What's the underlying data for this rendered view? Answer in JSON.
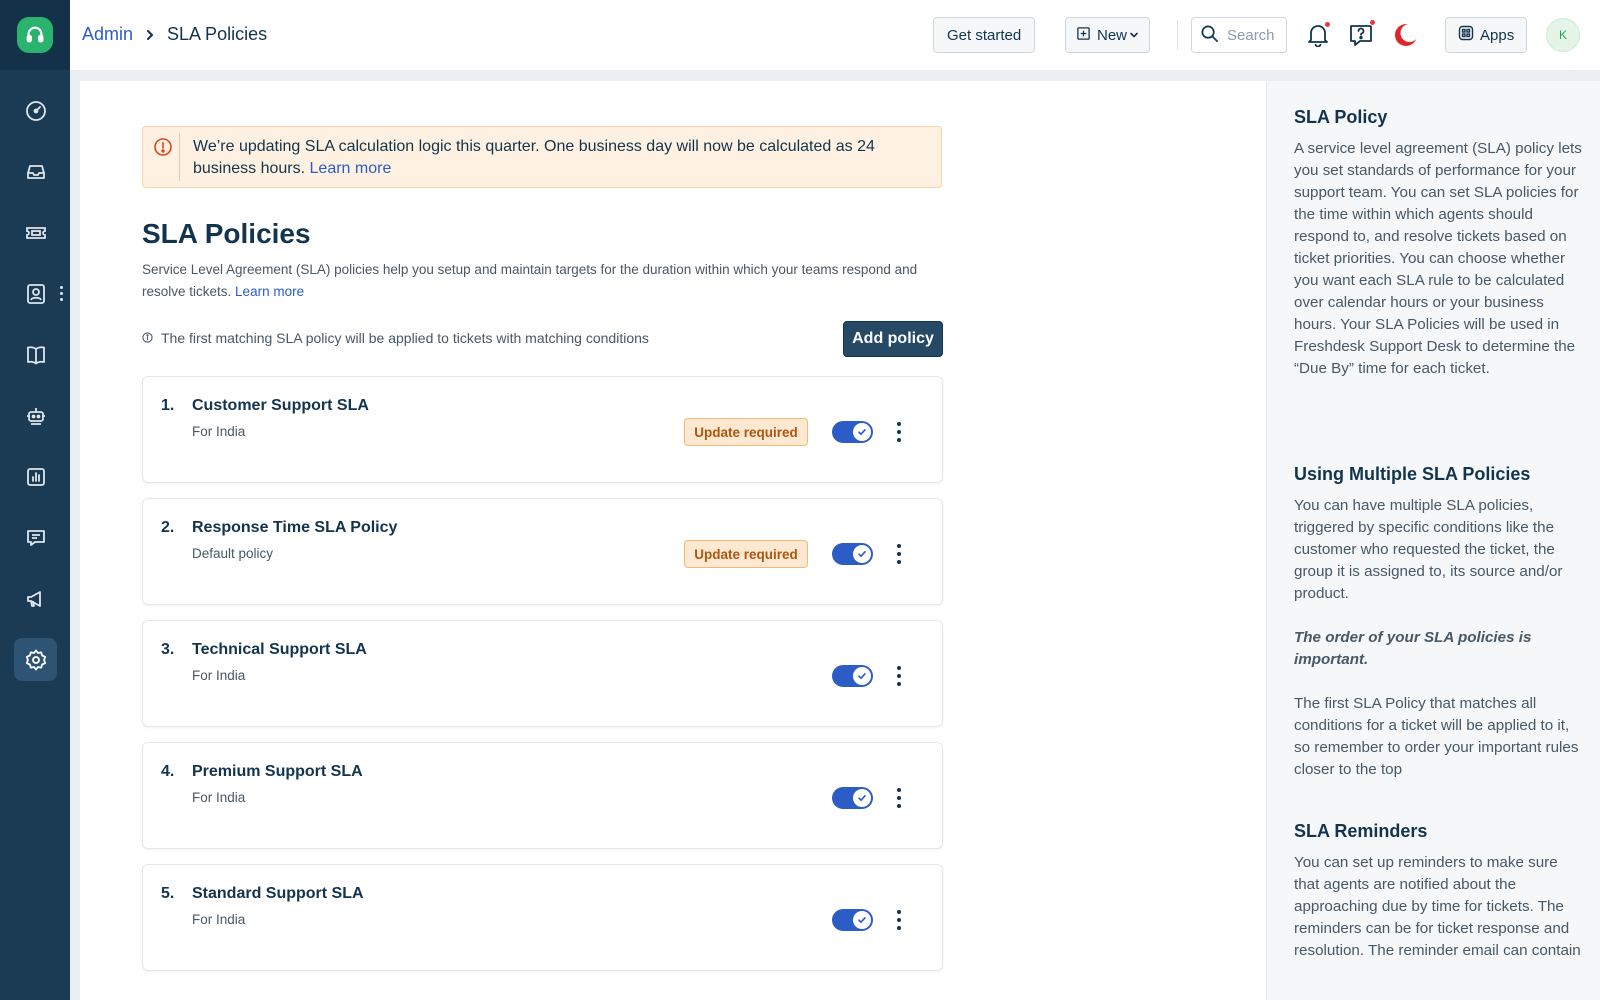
{
  "breadcrumb": {
    "admin": "Admin",
    "current": "SLA Policies"
  },
  "topbar": {
    "get_started": "Get started",
    "new_label": "New",
    "search_placeholder": "Search",
    "apps_label": "Apps",
    "avatar_initial": "K"
  },
  "banner": {
    "text": "We’re updating SLA calculation logic this quarter. One business day will now be calculated as 24 business hours.",
    "link": "Learn more"
  },
  "page": {
    "title": "SLA Policies",
    "description": "Service Level Agreement (SLA) policies help you setup and maintain targets for the duration within which your teams respond and resolve tickets.",
    "description_link": "Learn more",
    "info": "The first matching SLA policy will be applied to tickets with matching conditions",
    "add_button": "Add policy"
  },
  "policies": [
    {
      "num": "1.",
      "name": "Customer Support SLA",
      "sub": "For India",
      "badge": "Update required",
      "enabled": true
    },
    {
      "num": "2.",
      "name": "Response Time SLA Policy",
      "sub": "Default policy",
      "badge": "Update required",
      "enabled": true
    },
    {
      "num": "3.",
      "name": "Technical Support SLA",
      "sub": "For India",
      "badge": "",
      "enabled": true
    },
    {
      "num": "4.",
      "name": "Premium Support SLA",
      "sub": "For India",
      "badge": "",
      "enabled": true
    },
    {
      "num": "5.",
      "name": "Standard Support SLA",
      "sub": "For India",
      "badge": "",
      "enabled": true
    }
  ],
  "help": {
    "s1_title": "SLA Policy",
    "s1_body": "A service level agreement (SLA) policy lets you set standards of performance for your support team. You can set SLA policies for the time within which agents should respond to, and resolve tickets based on ticket priorities. You can choose whether you want each SLA rule to be calculated over calendar hours or your business hours. Your SLA Policies will be used in Freshdesk Support Desk to determine the “Due By” time for each ticket.",
    "s2_title": "Using Multiple SLA Policies",
    "s2_body": "You can have multiple SLA policies, triggered by specific conditions like the customer who requested the ticket, the group it is assigned to, its source and/or product.",
    "s2_emphasis": "The order of your SLA policies is important.",
    "s2_body2": "The first SLA Policy that matches all conditions for a ticket will be applied to it, so remember to order your important rules closer to the top",
    "s3_title": "SLA Reminders",
    "s3_body": "You can set up reminders to make sure that agents are notified about the approaching due by time for tickets. The reminders can be for ticket response and resolution. The reminder email can contain"
  },
  "colors": {
    "accent": "#2c5cc5",
    "nav_bg": "#1b3a53",
    "brand": "#29b36c",
    "badge_bg": "#fde9d2"
  },
  "nav_icons": [
    "dashboard-icon",
    "inbox-icon",
    "tickets-icon",
    "contacts-icon",
    "knowledge-base-icon",
    "bot-icon",
    "reports-icon",
    "conversations-icon",
    "campaigns-icon",
    "settings-icon"
  ]
}
